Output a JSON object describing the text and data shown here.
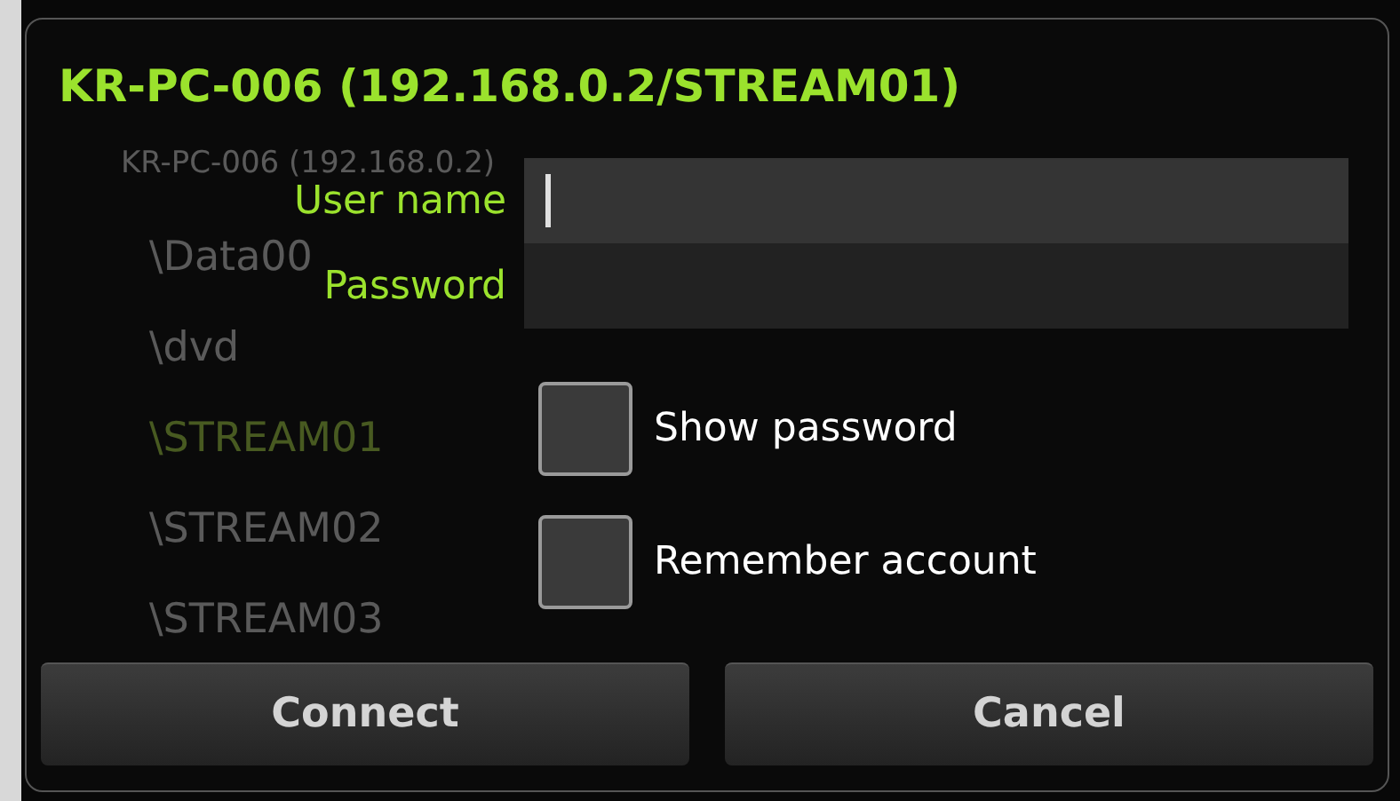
{
  "background_list": {
    "header": "KR-PC-006 (192.168.0.2)",
    "items": [
      {
        "label": "\\Data00",
        "selected": false
      },
      {
        "label": "\\dvd",
        "selected": false
      },
      {
        "label": "\\STREAM01",
        "selected": true
      },
      {
        "label": "\\STREAM02",
        "selected": false
      },
      {
        "label": "\\STREAM03",
        "selected": false
      }
    ]
  },
  "dialog": {
    "title": "KR-PC-006 (192.168.0.2/STREAM01)",
    "fields": [
      {
        "label": "User name",
        "focused": true
      },
      {
        "label": "Password",
        "focused": false
      }
    ],
    "checkboxes": [
      {
        "label": "Show password",
        "checked": false
      },
      {
        "label": "Remember account",
        "checked": false
      }
    ],
    "buttons": [
      "Connect",
      "Cancel"
    ]
  }
}
